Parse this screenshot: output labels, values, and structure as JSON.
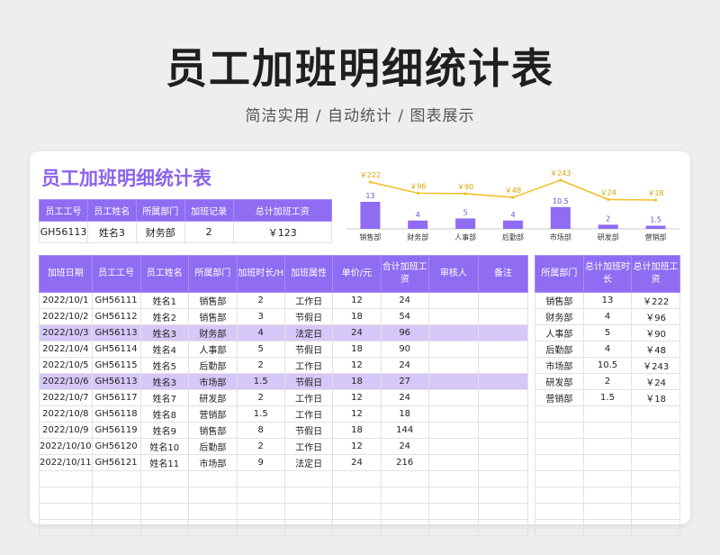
{
  "header": {
    "title": "员工加班明细统计表",
    "subtitle": "简洁实用 / 自动统计 / 图表展示"
  },
  "sheet": {
    "title": "员工加班明细统计表"
  },
  "summary": {
    "headers": [
      "员工工号",
      "员工姓名",
      "所属部门",
      "加班记录",
      "总计加班工资"
    ],
    "row": [
      "GH56113",
      "姓名3",
      "财务部",
      "2",
      "￥123"
    ]
  },
  "main_table": {
    "headers": [
      "加班日期",
      "员工工号",
      "员工姓名",
      "所属部门",
      "加班时长/H",
      "加班属性",
      "单价/元",
      "合计加班工资",
      "审核人",
      "备注"
    ],
    "rows": [
      [
        "2022/10/1",
        "GH56111",
        "姓名1",
        "销售部",
        "2",
        "工作日",
        "12",
        "24",
        "",
        ""
      ],
      [
        "2022/10/2",
        "GH56112",
        "姓名2",
        "销售部",
        "3",
        "节假日",
        "18",
        "54",
        "",
        ""
      ],
      [
        "2022/10/3",
        "GH56113",
        "姓名3",
        "财务部",
        "4",
        "法定日",
        "24",
        "96",
        "",
        ""
      ],
      [
        "2022/10/4",
        "GH56114",
        "姓名4",
        "人事部",
        "5",
        "节假日",
        "18",
        "90",
        "",
        ""
      ],
      [
        "2022/10/5",
        "GH56115",
        "姓名5",
        "后勤部",
        "2",
        "工作日",
        "12",
        "24",
        "",
        ""
      ],
      [
        "2022/10/6",
        "GH56113",
        "姓名3",
        "市场部",
        "1.5",
        "节假日",
        "18",
        "27",
        "",
        ""
      ],
      [
        "2022/10/7",
        "GH56117",
        "姓名7",
        "研发部",
        "2",
        "工作日",
        "12",
        "24",
        "",
        ""
      ],
      [
        "2022/10/8",
        "GH56118",
        "姓名8",
        "营销部",
        "1.5",
        "工作日",
        "12",
        "18",
        "",
        ""
      ],
      [
        "2022/10/9",
        "GH56119",
        "姓名9",
        "销售部",
        "8",
        "节假日",
        "18",
        "144",
        "",
        ""
      ],
      [
        "2022/10/10",
        "GH56120",
        "姓名10",
        "后勤部",
        "2",
        "工作日",
        "12",
        "24",
        "",
        ""
      ],
      [
        "2022/10/11",
        "GH56121",
        "姓名11",
        "市场部",
        "9",
        "法定日",
        "24",
        "216",
        "",
        ""
      ],
      [
        "",
        "",
        "",
        "",
        "",
        "",
        "",
        "",
        "",
        ""
      ],
      [
        "",
        "",
        "",
        "",
        "",
        "",
        "",
        "",
        "",
        ""
      ],
      [
        "",
        "",
        "",
        "",
        "",
        "",
        "",
        "",
        "",
        ""
      ],
      [
        "",
        "",
        "",
        "",
        "",
        "",
        "",
        "",
        "",
        ""
      ]
    ],
    "highlight_rows": [
      2,
      5
    ]
  },
  "dept_stats": {
    "headers": [
      "所属部门",
      "总计加班时长",
      "总计加班工资"
    ],
    "rows": [
      [
        "销售部",
        "13",
        "￥222"
      ],
      [
        "财务部",
        "4",
        "￥96"
      ],
      [
        "人事部",
        "5",
        "￥90"
      ],
      [
        "后勤部",
        "4",
        "￥48"
      ],
      [
        "市场部",
        "10.5",
        "￥243"
      ],
      [
        "研发部",
        "2",
        "￥24"
      ],
      [
        "营销部",
        "1.5",
        "￥18"
      ],
      [
        "",
        "",
        ""
      ],
      [
        "",
        "",
        ""
      ],
      [
        "",
        "",
        ""
      ],
      [
        "",
        "",
        ""
      ],
      [
        "",
        "",
        ""
      ],
      [
        "",
        "",
        ""
      ],
      [
        "",
        "",
        ""
      ],
      [
        "",
        "",
        ""
      ]
    ]
  },
  "colors": {
    "accent": "#8f6cf2",
    "bar": "#8f6cf2",
    "line": "#f2c02c",
    "highlight": "#d5c7f7"
  },
  "chart_data": {
    "type": "bar",
    "categories": [
      "销售部",
      "财务部",
      "人事部",
      "后勤部",
      "市场部",
      "研发部",
      "营销部"
    ],
    "series": [
      {
        "values": [
          13,
          4,
          5,
          4,
          10.5,
          2,
          1.5
        ]
      },
      {
        "type": "line",
        "values": [
          222,
          96,
          90,
          48,
          243,
          24,
          18
        ]
      }
    ],
    "bar_labels": [
      "13",
      "4",
      "5",
      "4",
      "10.5",
      "2",
      "1.5"
    ],
    "line_labels": [
      "￥222",
      "￥96",
      "￥90",
      "￥48",
      "￥243",
      "￥24",
      "￥18"
    ]
  }
}
